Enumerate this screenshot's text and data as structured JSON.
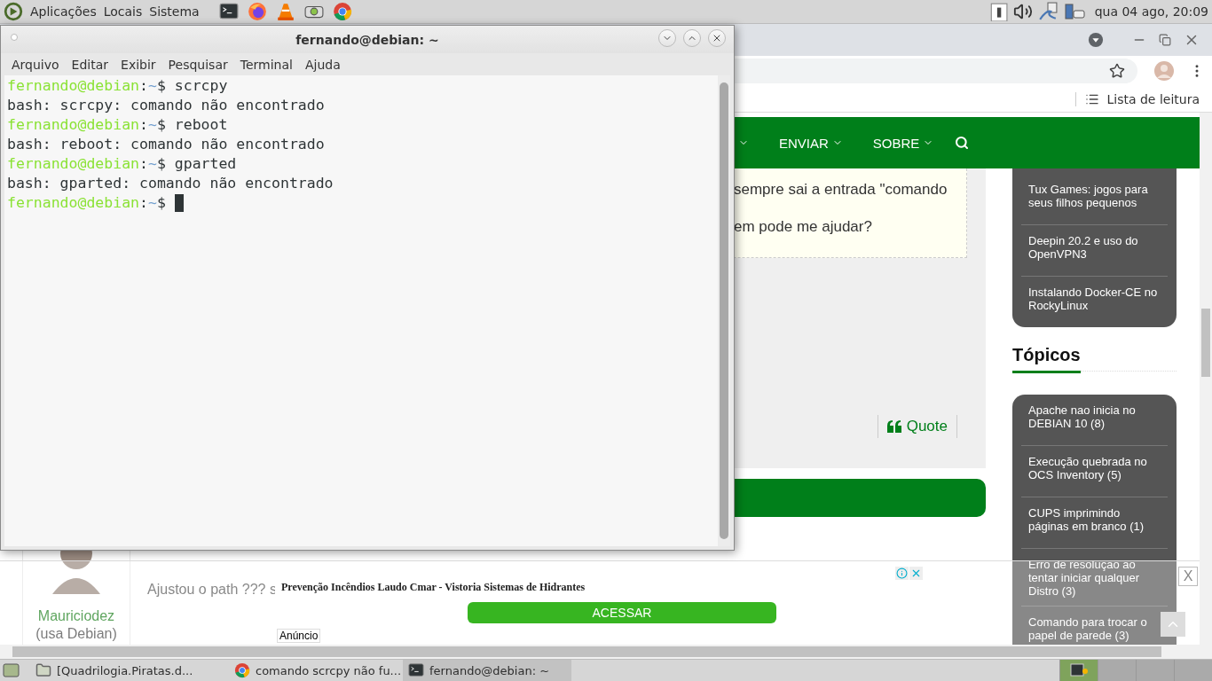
{
  "top_panel": {
    "menus": [
      "Aplicações",
      "Locais",
      "Sistema"
    ],
    "clock": "qua 04 ago, 20:09"
  },
  "browser": {
    "bookmarks": [
      "Lista de leitura"
    ],
    "nav": [
      "ENVIAR",
      "SOBRE"
    ],
    "post_lines": [
      "sempre sai a entrada \"comando",
      "em pode me ajudar?"
    ],
    "quote": "Quote",
    "recent_posts": [
      "Tux Games: jogos para seus filhos pequenos",
      "Deepin 20.2 e uso do OpenVPN3",
      "Instalando Docker-CE no RockyLinux"
    ],
    "topics_title": "Tópicos",
    "topics": [
      "Apache nao inicia no DEBIAN 10 (8)",
      "Execução quebrada no OCS Inventory (5)",
      "CUPS imprimindo páginas em branco (1)",
      "Erro de resolução ao tentar iniciar qualquer Distro (3)",
      "Comando para trocar o papel de parede (3)"
    ],
    "comment": {
      "author": "Mauriciodez",
      "author_note": "(usa Debian)",
      "text": "Ajustou o path ??? s"
    },
    "ad": {
      "title": "Prevenção Incêndios Laudo Cmar - Vistoria Sistemas de Hidrantes",
      "button": "ACESSAR",
      "label": "Anúncio",
      "close": "X"
    }
  },
  "terminal": {
    "title": "fernando@debian: ~",
    "menus": [
      "Arquivo",
      "Editar",
      "Exibir",
      "Pesquisar",
      "Terminal",
      "Ajuda"
    ],
    "lines": [
      {
        "kind": "prompt",
        "user": "fernando@debian",
        "separator": ":",
        "path": "~",
        "symbol": "$",
        "command": "scrcpy",
        "cursor": false
      },
      {
        "kind": "output",
        "text": "bash: scrcpy: comando não encontrado"
      },
      {
        "kind": "prompt",
        "user": "fernando@debian",
        "separator": ":",
        "path": "~",
        "symbol": "$",
        "command": "reboot",
        "cursor": false
      },
      {
        "kind": "output",
        "text": "bash: reboot: comando não encontrado"
      },
      {
        "kind": "prompt",
        "user": "fernando@debian",
        "separator": ":",
        "path": "~",
        "symbol": "$",
        "command": "gparted",
        "cursor": false
      },
      {
        "kind": "output",
        "text": "bash: gparted: comando não encontrado"
      },
      {
        "kind": "prompt",
        "user": "fernando@debian",
        "separator": ":",
        "path": "~",
        "symbol": "$",
        "cursor": true
      }
    ]
  },
  "taskbar": {
    "tasks": [
      {
        "kind": "folder",
        "label": "[Quadrilogia.Piratas.d...",
        "selected": false
      },
      {
        "kind": "browser",
        "label": "comando scrcpy não fu...",
        "selected": false
      },
      {
        "kind": "terminal",
        "label": "fernando@debian: ~",
        "selected": true
      }
    ],
    "workspaces": [
      {
        "selected": true
      },
      {
        "selected": false
      },
      {
        "selected": false
      },
      {
        "selected": false
      }
    ]
  }
}
